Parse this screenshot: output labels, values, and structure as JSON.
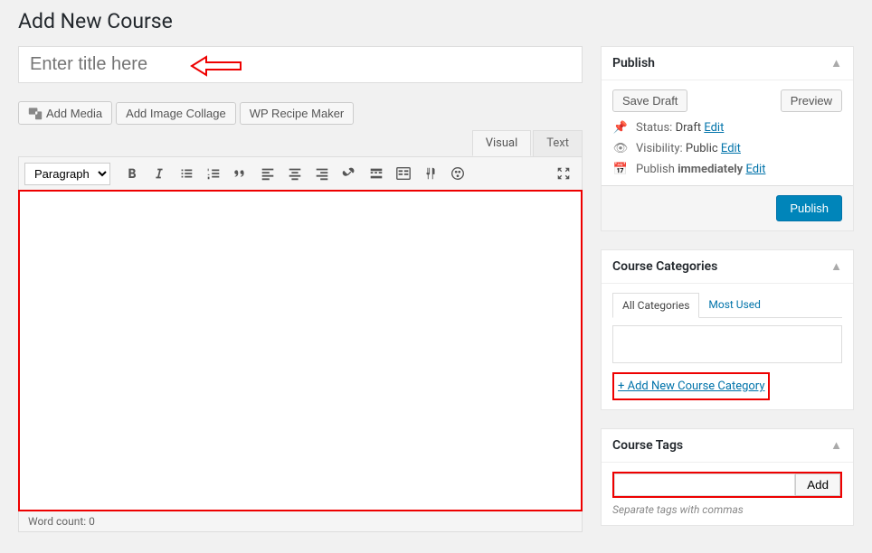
{
  "page_title": "Add New Course",
  "title_placeholder": "Enter title here",
  "media_buttons": {
    "add_media": "Add Media",
    "add_collage": "Add Image Collage",
    "wp_recipe": "WP Recipe Maker"
  },
  "editor": {
    "tabs": {
      "visual": "Visual",
      "text": "Text"
    },
    "format_select": "Paragraph",
    "footer": "Word count: 0"
  },
  "publish": {
    "title": "Publish",
    "save_draft": "Save Draft",
    "preview": "Preview",
    "status_label": "Status:",
    "status_value": "Draft",
    "visibility_label": "Visibility:",
    "visibility_value": "Public",
    "publish_label": "Publish",
    "publish_value": "immediately",
    "edit": "Edit",
    "publish_button": "Publish"
  },
  "categories": {
    "title": "Course Categories",
    "tabs": {
      "all": "All Categories",
      "most_used": "Most Used"
    },
    "add_new": "+ Add New Course Category"
  },
  "tags": {
    "title": "Course Tags",
    "add": "Add",
    "hint": "Separate tags with commas"
  }
}
